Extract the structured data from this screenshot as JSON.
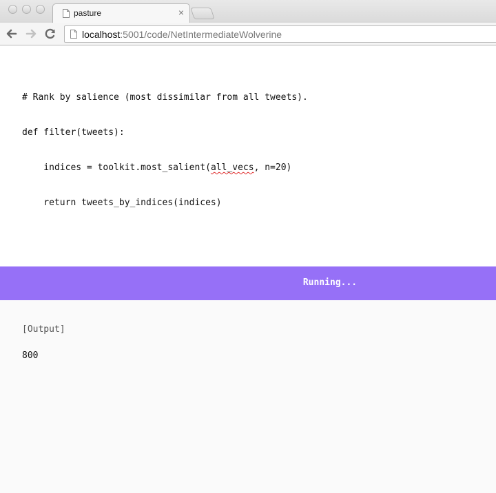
{
  "browser": {
    "tab": {
      "title": "pasture"
    },
    "tab_close_glyph": "×",
    "url": {
      "host": "localhost",
      "rest": ":5001/code/NetIntermediateWolverine"
    },
    "icons": [
      "close-window-icon",
      "minimize-window-icon",
      "maximize-window-icon",
      "page-icon",
      "back-arrow-icon",
      "forward-arrow-icon",
      "reload-icon"
    ]
  },
  "editor": {
    "lines": [
      "# Rank by salience (most dissimilar from all tweets).",
      "def filter(tweets):",
      "    indices = toolkit.most_salient(",
      "    return tweets_by_indices(indices)"
    ],
    "line3_misspelled": "all_vecs",
    "line3_tail": ", n=20)"
  },
  "runbar": {
    "status": "Running...",
    "color": "#9670f7"
  },
  "output": {
    "label": "[Output]",
    "value": "800"
  }
}
